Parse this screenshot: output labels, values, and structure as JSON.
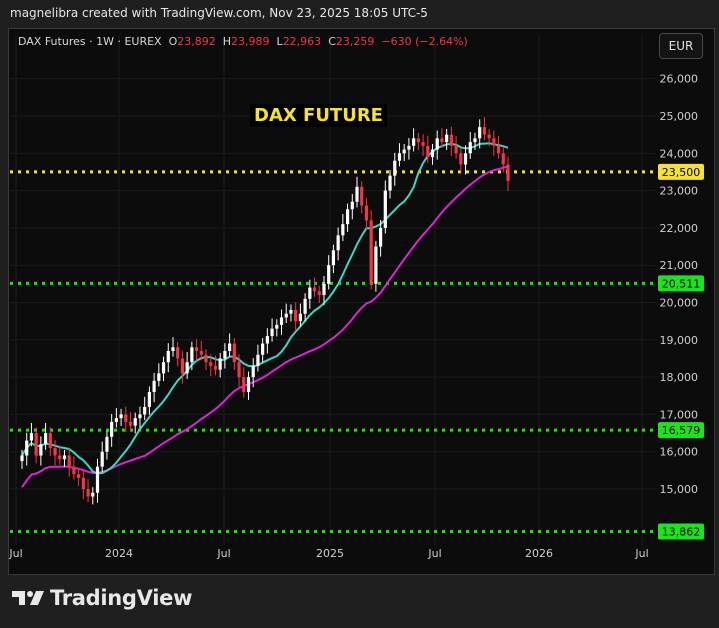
{
  "header": {
    "credit": "magnelibra created with TradingView.com, Nov 23, 2025 18:05 UTC-5"
  },
  "legend": {
    "symbol": "DAX Futures · 1W · EUREX",
    "open_label": "O",
    "open": "23,892",
    "high_label": "H",
    "high": "23,989",
    "low_label": "L",
    "low": "22,963",
    "close_label": "C",
    "close": "23,259",
    "change": "−630 (−2.64%)"
  },
  "currency_button": "EUR",
  "brand": {
    "name": "TradingView",
    "logo_icon": "tradingview-logo-icon"
  },
  "colors": {
    "up": "#ffffff",
    "down": "#f23645",
    "ma_fast": "#3dd6c0",
    "ma_slow": "#e021d6",
    "level_yellow": "#f5e130",
    "level_green": "#19e619",
    "background": "#0c0c0c"
  },
  "chart_data": {
    "type": "candlestick",
    "title": "DAX FUTURE",
    "timeframe": "1W",
    "x_ticks": [
      "Jul",
      "2024",
      "Jul",
      "2025",
      "Jul",
      "2026",
      "Jul"
    ],
    "y_ticks": [
      "15,000",
      "16,000",
      "17,000",
      "18,000",
      "19,000",
      "20,000",
      "21,000",
      "22,000",
      "23,000",
      "24,000",
      "25,000",
      "26,000"
    ],
    "ylim": [
      13500,
      26500
    ],
    "levels": [
      {
        "label": "23,500",
        "value": 23500,
        "color": "#f5e130"
      },
      {
        "label": "20,511",
        "value": 20511,
        "color": "#19e619"
      },
      {
        "label": "16,579",
        "value": 16579,
        "color": "#19e619"
      },
      {
        "label": "13,862",
        "value": 13862,
        "color": "#19e619"
      }
    ],
    "closes": [
      15900,
      16300,
      16500,
      15900,
      16200,
      16500,
      16100,
      15900,
      15800,
      15900,
      15600,
      15400,
      15300,
      15000,
      14800,
      14900,
      15600,
      16000,
      16400,
      16800,
      16900,
      17000,
      16800,
      16700,
      16900,
      17000,
      17200,
      17600,
      17900,
      18100,
      18400,
      18700,
      18800,
      18500,
      18100,
      18400,
      18800,
      18700,
      18600,
      18400,
      18300,
      18200,
      18500,
      18700,
      18900,
      18400,
      18000,
      17600,
      18000,
      18300,
      18600,
      18900,
      19100,
      19300,
      19400,
      19600,
      19700,
      19800,
      19500,
      19700,
      20100,
      20400,
      20300,
      20200,
      20500,
      21000,
      21400,
      21800,
      22100,
      22500,
      22700,
      23100,
      22600,
      22200,
      20500,
      21500,
      22000,
      23000,
      23400,
      23800,
      24000,
      24100,
      24200,
      24400,
      24300,
      24200,
      23900,
      24100,
      24400,
      24300,
      24500,
      24200,
      24000,
      23700,
      24000,
      24300,
      24400,
      24700,
      24500,
      24400,
      24200,
      24000,
      23700,
      23259
    ],
    "ma_fast_name": "",
    "ma_slow_name": ""
  }
}
